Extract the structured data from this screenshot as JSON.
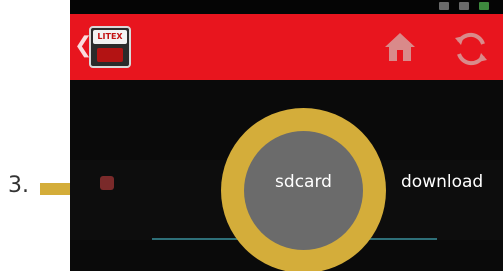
{
  "annotation": {
    "step_number": "3.",
    "highlight_color": "#d4ad3a"
  },
  "appbar": {
    "background_color": "#e8151e",
    "logo_text": "LITEX",
    "back_icon": "chevron-left-icon",
    "home_icon": "home-icon",
    "refresh_icon": "refresh-icon"
  },
  "breadcrumbs": {
    "items": [
      {
        "label": "sdcard",
        "highlighted": true
      },
      {
        "label": "download",
        "highlighted": false
      }
    ],
    "underline_color": "#2e6f78"
  },
  "status_bar": {
    "icons": [
      "notification-icon",
      "signal-icon",
      "battery-icon"
    ]
  }
}
